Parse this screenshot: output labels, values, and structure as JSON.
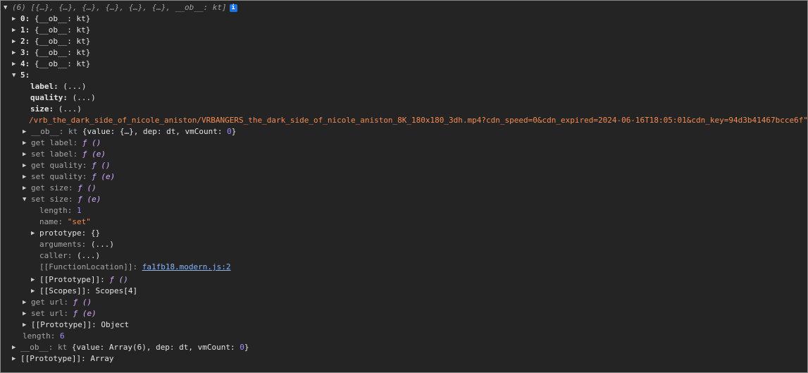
{
  "header": {
    "text": "(6) [{…}, {…}, {…}, {…}, {…}, {…}, __ob__: kt]",
    "info_icon": "i"
  },
  "items": [
    {
      "key": "0",
      "value": "{__ob__: kt}"
    },
    {
      "key": "1",
      "value": "{__ob__: kt}"
    },
    {
      "key": "2",
      "value": "{__ob__: kt}"
    },
    {
      "key": "3",
      "value": "{__ob__: kt}"
    },
    {
      "key": "4",
      "value": "{__ob__: kt}"
    }
  ],
  "item5": {
    "key": "5:",
    "label": {
      "k": "label:",
      "v": "(...)"
    },
    "quality": {
      "k": "quality:",
      "v": "(...)"
    },
    "size": {
      "k": "size:",
      "v": "(...)"
    },
    "url_string": "/vrb_the_dark_side_of_nicole_aniston/VRBANGERS_the_dark_side_of_nicole_aniston_8K_180x180_3dh.mp4?cdn_speed=0&cdn_expired=2024-06-16T18:05:01&cdn_key=94d3b41467bcce6f\"",
    "ob": {
      "k": "__ob__:",
      "type": "kt",
      "pre": "{value: {…}, dep: dt, vmCount:",
      "count": "0",
      "post": "}"
    },
    "get_label": {
      "k": "get label:",
      "f": "ƒ ()"
    },
    "set_label": {
      "k": "set label:",
      "f": "ƒ (e)"
    },
    "get_quality": {
      "k": "get quality:",
      "f": "ƒ ()"
    },
    "set_quality": {
      "k": "set quality:",
      "f": "ƒ (e)"
    },
    "get_size": {
      "k": "get size:",
      "f": "ƒ ()"
    },
    "set_size": {
      "k": "set size:",
      "f": "ƒ (e)"
    },
    "set_size_children": {
      "length": {
        "k": "length:",
        "v": "1"
      },
      "name": {
        "k": "name:",
        "v": "\"set\""
      },
      "prototype": {
        "k": "prototype:",
        "v": "{}"
      },
      "arguments": {
        "k": "arguments:",
        "v": "(...)"
      },
      "caller": {
        "k": "caller:",
        "v": "(...)"
      },
      "location": {
        "k": "[[FunctionLocation]]:",
        "v": "fa1fb18.modern.js:2"
      },
      "proto": {
        "k": "[[Prototype]]:",
        "v": "ƒ ()"
      },
      "scopes": {
        "k": "[[Scopes]]:",
        "v": "Scopes[4]"
      }
    },
    "get_url": {
      "k": "get url:",
      "f": "ƒ ()"
    },
    "set_url": {
      "k": "set url:",
      "f": "ƒ (e)"
    },
    "prototype": {
      "k": "[[Prototype]]:",
      "v": "Object"
    }
  },
  "length": {
    "k": "length:",
    "v": "6"
  },
  "ob": {
    "k": "__ob__:",
    "type": "kt",
    "pre": "{value: Array(6), dep: dt, vmCount:",
    "count": "0",
    "post": "}"
  },
  "prototype": {
    "k": "[[Prototype]]:",
    "v": "Array"
  }
}
